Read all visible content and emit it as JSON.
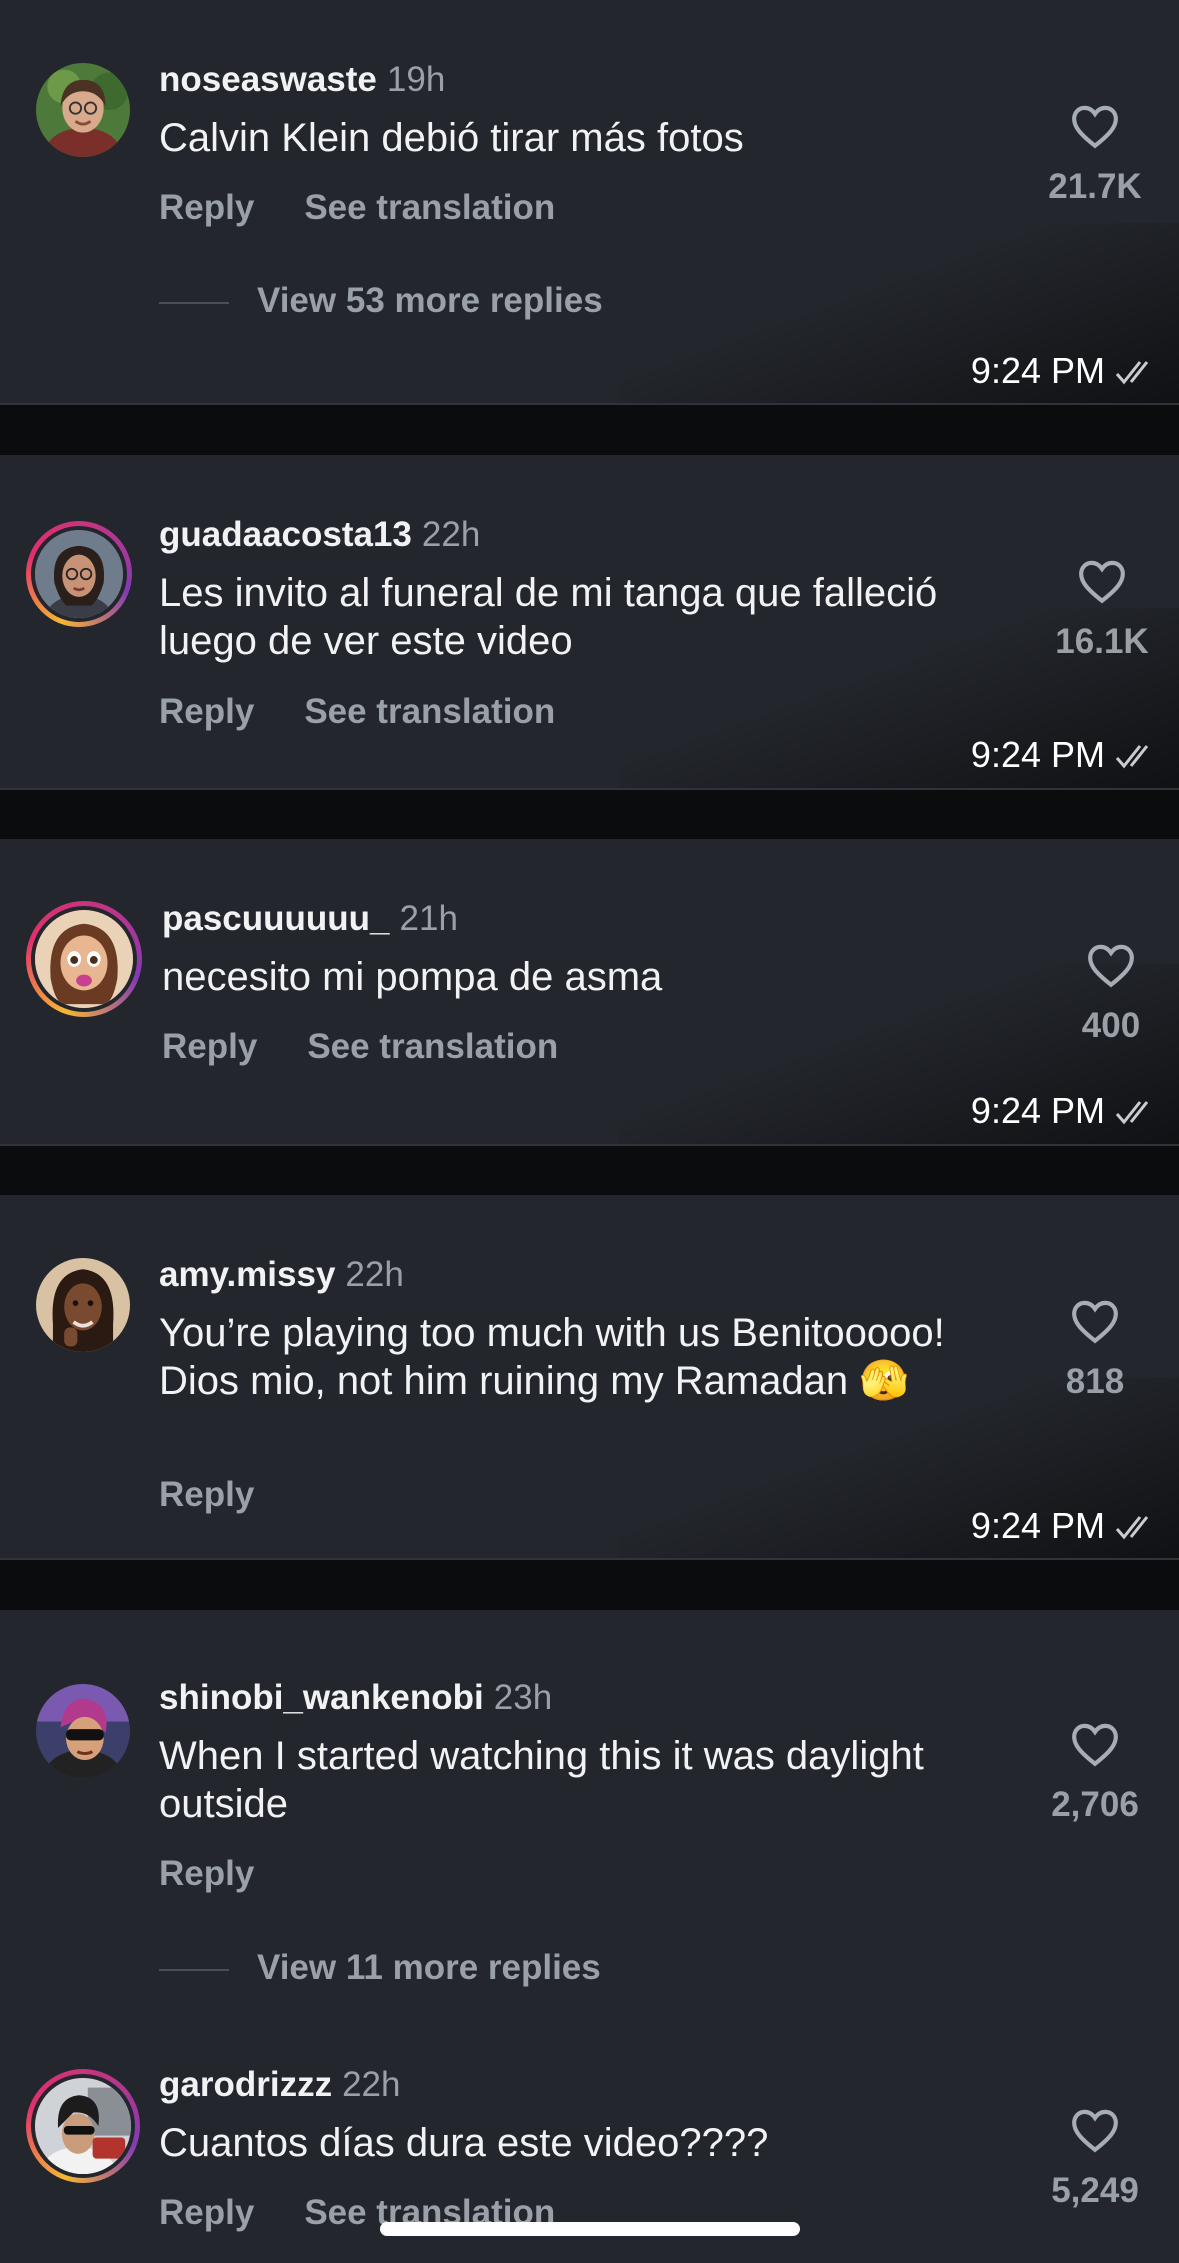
{
  "comments": [
    {
      "username": "noseaswaste",
      "age": "19h",
      "text": "Calvin Klein debió tirar más fotos",
      "reply_label": "Reply",
      "translate_label": "See translation",
      "likes": "21.7K",
      "more_replies": "View 53 more replies",
      "timestamp": "9:24 PM"
    },
    {
      "username": "guadaacosta13",
      "age": "22h",
      "text": "Les invito al funeral de mi tanga que falleció luego de ver este video",
      "reply_label": "Reply",
      "translate_label": "See translation",
      "likes": "16.1K",
      "timestamp": "9:24 PM"
    },
    {
      "username": "pascuuuuuu_",
      "age": "21h",
      "text": "necesito mi pompa de asma",
      "reply_label": "Reply",
      "translate_label": "See translation",
      "likes": "400",
      "timestamp": "9:24 PM"
    },
    {
      "username": "amy.missy",
      "age": "22h",
      "text": "You’re playing too much with us Benitooooo! Dios mio, not him ruining my Ramadan 🫣",
      "reply_label": "Reply",
      "likes": "818",
      "timestamp": "9:24 PM"
    },
    {
      "username": "shinobi_wankenobi",
      "age": "23h",
      "text": "When I started watching this it was daylight outside",
      "reply_label": "Reply",
      "likes": "2,706",
      "more_replies": "View 11 more replies"
    },
    {
      "username": "garodrizzz",
      "age": "22h",
      "text": "Cuantos días dura este video????",
      "reply_label": "Reply",
      "translate_label": "See translation",
      "likes": "5,249"
    }
  ],
  "icons": {
    "like": "heart-outline-icon",
    "read_receipt": "double-check-icon"
  },
  "colors": {
    "card_bg": "#23262c",
    "page_bg": "#0b0c0d",
    "muted_text": "#9aa0a8"
  }
}
